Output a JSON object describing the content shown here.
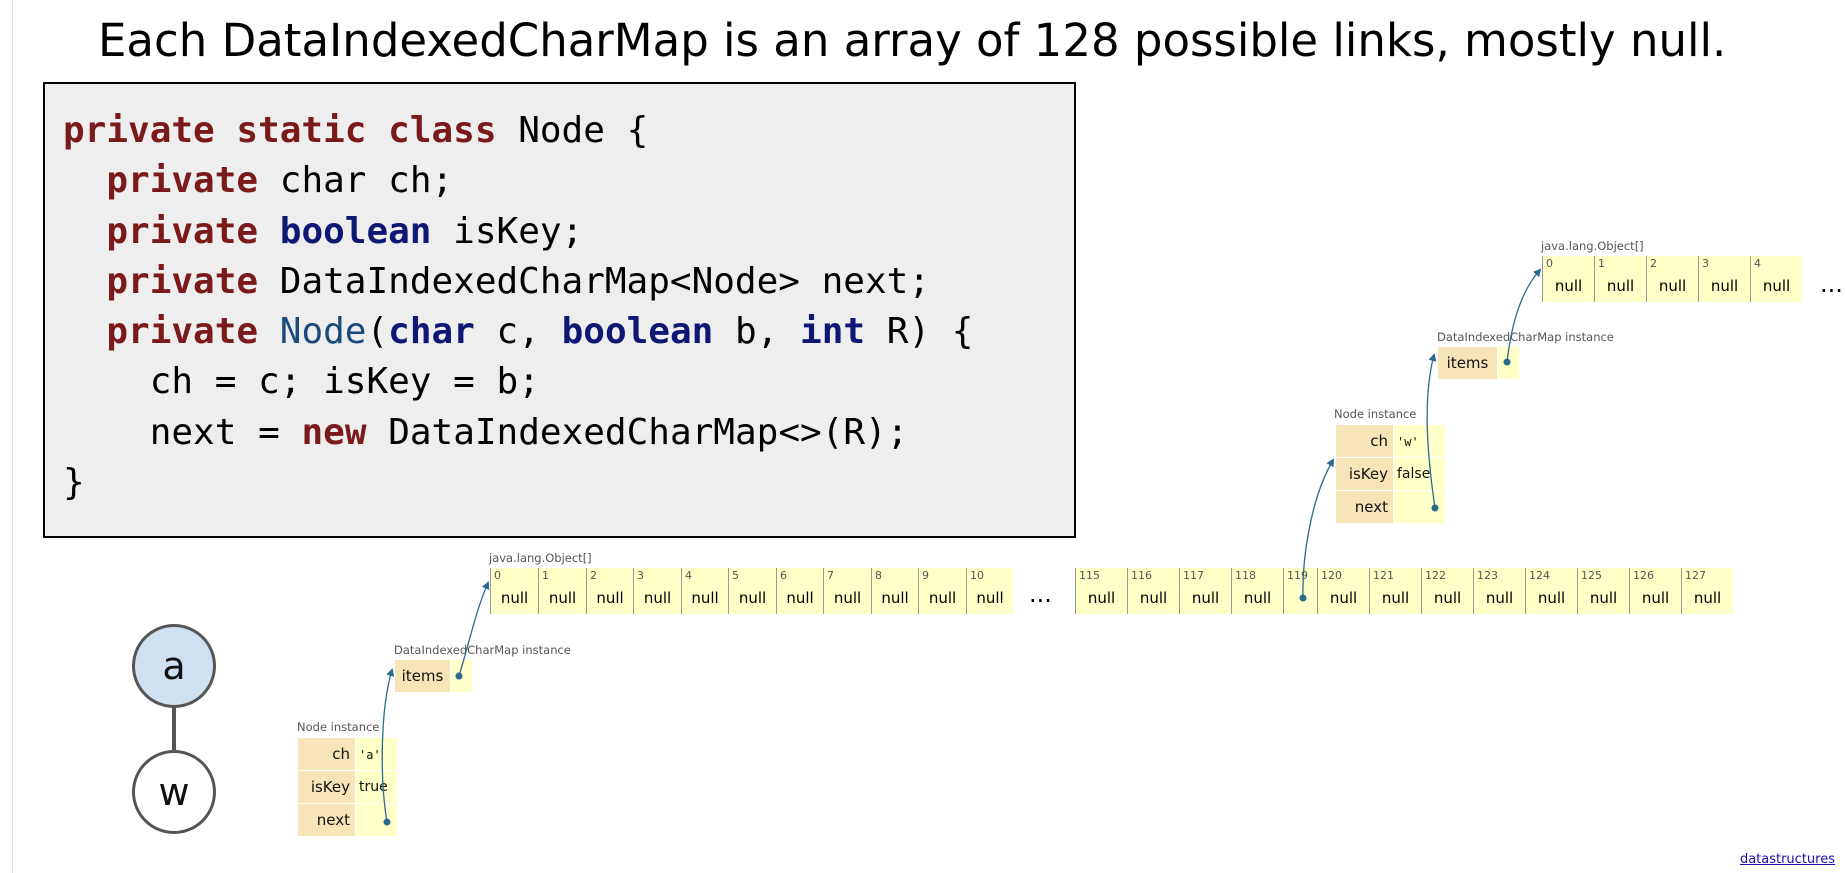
{
  "title": "Each DataIndexedCharMap is an array of 128 possible links, mostly null.",
  "code": {
    "l1": [
      "private",
      "static",
      "class",
      "Node",
      "{"
    ],
    "l2": [
      "private",
      "char",
      "ch",
      ";"
    ],
    "l3": [
      "private",
      "boolean",
      "isKey",
      ";"
    ],
    "l4": [
      "private",
      "DataIndexedCharMap<Node>",
      "next;"
    ],
    "l5": [
      "private",
      "Node",
      "(",
      "char",
      "c,",
      "boolean",
      "b,",
      "int",
      "R) {"
    ],
    "l6": "ch = c; isKey = b;",
    "l7": [
      "next",
      "=",
      "new",
      "DataIndexedCharMap<>(R);"
    ],
    "l8": "}"
  },
  "labels": {
    "node_instance": "Node instance",
    "map_instance": "DataIndexedCharMap instance",
    "object_array": "java.lang.Object[]"
  },
  "node_a": {
    "fields": [
      {
        "key": "ch",
        "value": "'a'"
      },
      {
        "key": "isKey",
        "value": "true"
      },
      {
        "key": "next",
        "value": ""
      }
    ]
  },
  "node_w": {
    "fields": [
      {
        "key": "ch",
        "value": "'w'"
      },
      {
        "key": "isKey",
        "value": "false"
      },
      {
        "key": "next",
        "value": ""
      }
    ]
  },
  "map_items_label": "items",
  "null_text": "null",
  "ellipsis": "...",
  "array_big": {
    "first_indices": [
      "0",
      "1",
      "2",
      "3",
      "4",
      "5",
      "6",
      "7",
      "8",
      "9",
      "10"
    ],
    "last_indices": [
      "115",
      "116",
      "117",
      "118",
      "119",
      "120",
      "121",
      "122",
      "123",
      "124",
      "125",
      "126",
      "127"
    ],
    "pointer_index": "119"
  },
  "array_small": {
    "indices": [
      "0",
      "1",
      "2",
      "3",
      "4"
    ]
  },
  "trie": {
    "nodes": [
      "a",
      "w"
    ],
    "colors": {
      "root_fill": "#cfe0f1",
      "child_fill": "#ffffff",
      "edge": "#555555"
    }
  },
  "colors": {
    "arrow": "#2b6a8f",
    "key_bg": "#f7e4b9",
    "value_bg": "#ffffc8",
    "code_bg": "#eeeeee"
  },
  "footer_link": "datastructures"
}
